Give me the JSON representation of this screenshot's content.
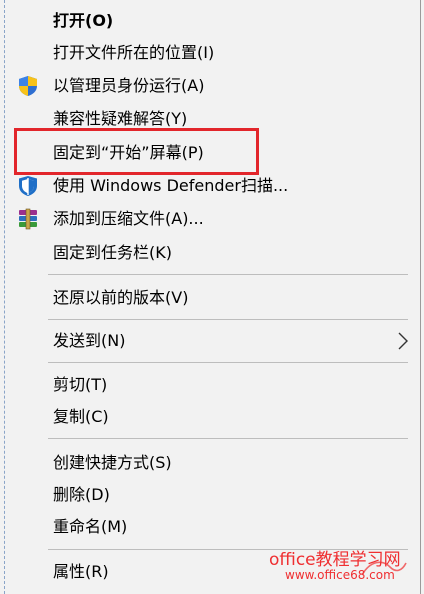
{
  "menu": {
    "items": [
      {
        "label": "打开(O)"
      },
      {
        "label": "打开文件所在的位置(I)"
      },
      {
        "label": "以管理员身份运行(A)"
      },
      {
        "label": "兼容性疑难解答(Y)"
      },
      {
        "label": "固定到“开始”屏幕(P)"
      },
      {
        "label": "使用 Windows Defender扫描..."
      },
      {
        "label": "添加到压缩文件(A)..."
      },
      {
        "label": "固定到任务栏(K)"
      },
      {
        "label": "还原以前的版本(V)"
      },
      {
        "label": "发送到(N)"
      },
      {
        "label": "剪切(T)"
      },
      {
        "label": "复制(C)"
      },
      {
        "label": "创建快捷方式(S)"
      },
      {
        "label": "删除(D)"
      },
      {
        "label": "重命名(M)"
      },
      {
        "label": "属性(R)"
      }
    ]
  },
  "watermark": {
    "title": "office教程学习网",
    "url": "www.office68.com"
  },
  "colors": {
    "highlight_box": "#e2262b",
    "watermark": "#ef2f31",
    "menu_bg": "#f2f2f2",
    "separator": "#bdbdbd"
  },
  "icons": {
    "run_as_admin": "uac-shield-icon",
    "defender": "defender-shield-icon",
    "archive": "winrar-books-icon",
    "send_to": "chevron-right-icon"
  }
}
